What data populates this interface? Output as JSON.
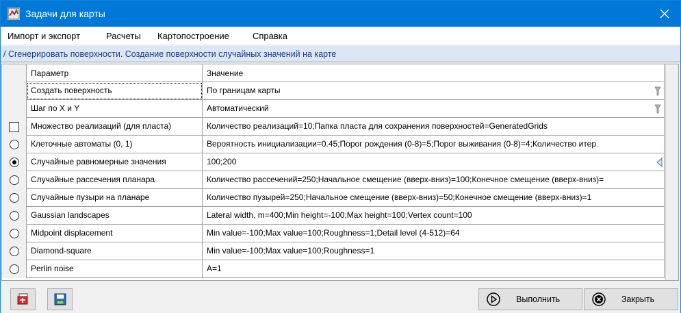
{
  "window": {
    "title": "Задачи для карты"
  },
  "menu": [
    "Импорт и экспорт",
    "Расчеты",
    "Картопостроение",
    "Справка"
  ],
  "breadcrumb": "/ Сгенерировать поверхности. Создание поверхности случайных значений на карте",
  "table": {
    "headers": {
      "param": "Параметр",
      "value": "Значение"
    },
    "rows": [
      {
        "param": "Создать поверхность",
        "value": "По границам карты",
        "control": "none",
        "widget": "dropdown"
      },
      {
        "param": "Шаг по X и Y",
        "value": "Автоматический",
        "control": "none",
        "widget": "dropdown"
      },
      {
        "param": "Множество реализаций (для пласта)",
        "value": "Количество реализаций=10;Папка пласта для сохранения поверхностей=GeneratedGrids",
        "control": "checkbox",
        "checked": false
      },
      {
        "param": "Клеточные автоматы (0, 1)",
        "value": "Вероятность инициализации=0.45;Порог рождения (0-8)=5;Порог выживания (0-8)=4;Количество итер",
        "control": "radio",
        "checked": false
      },
      {
        "param": "Случайные равномерные значения",
        "value": "100;200",
        "control": "radio",
        "checked": true,
        "widget": "edit"
      },
      {
        "param": "Случайные рассечения планара",
        "value": "Количество рассечений=250;Начальное смещение (вверх-вниз)=100;Конечное смещение (вверх-вниз)=",
        "control": "radio",
        "checked": false
      },
      {
        "param": "Случайные пузыри на планаре",
        "value": "Количество пузырей=250;Начальное смещение (вверх-вниз)=50;Конечное смещение (вверх-вниз)=1",
        "control": "radio",
        "checked": false
      },
      {
        "param": "Gaussian landscapes",
        "value": "Lateral width, m=400;Min height=-100;Max height=100;Vertex count=100",
        "control": "radio",
        "checked": false
      },
      {
        "param": "Midpoint displacement",
        "value": "Min value=-100;Max value=100;Roughness=1;Detail level (4-512)=64",
        "control": "radio",
        "checked": false
      },
      {
        "param": "Diamond-square",
        "value": "Min value=-100;Max value=100;Roughness=1",
        "control": "radio",
        "checked": false
      },
      {
        "param": "Perlin noise",
        "value": "A=1",
        "control": "radio",
        "checked": false
      }
    ]
  },
  "buttons": {
    "run": "Выполнить",
    "close": "Закрыть"
  },
  "icons": {
    "app": "map-tasks-icon",
    "close": "close-icon",
    "run": "play-circle-icon",
    "closeBtn": "cancel-circle-icon",
    "tool1": "export-layer-icon",
    "tool2": "save-disk-icon"
  },
  "colors": {
    "titlebar": "#0078d7",
    "breadcrumb_bg": "#dce6f4",
    "breadcrumb_text": "#1b3e8a"
  }
}
